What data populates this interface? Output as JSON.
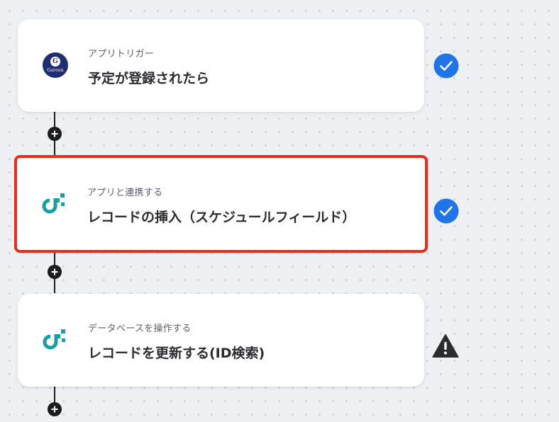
{
  "colors": {
    "canvas_bg": "#eef0f3",
    "card_bg": "#ffffff",
    "connector": "#1c1c1e",
    "check_blue": "#1f75e8",
    "warning": "#2a2c30",
    "highlight_border": "#ee2a1b",
    "garoon_brand": "#1f2d72",
    "data_app_teal": "#1a9ea6"
  },
  "flow": {
    "steps": [
      {
        "subtitle": "アプリトリガー",
        "title": "予定が登録されたら",
        "icon": "garoon-logo-icon",
        "icon_letter": "G",
        "icon_word": "Garoon",
        "status": "complete-check-icon",
        "highlighted": false
      },
      {
        "subtitle": "アプリと連携する",
        "title": "レコードの挿入（スケジュールフィールド）",
        "icon": "data-app-logo-icon",
        "status": "complete-check-icon",
        "highlighted": true
      },
      {
        "subtitle": "データベースを操作する",
        "title": "レコードを更新する(ID検索)",
        "icon": "data-app-logo-icon",
        "status": "warning-icon",
        "highlighted": false
      }
    ]
  }
}
